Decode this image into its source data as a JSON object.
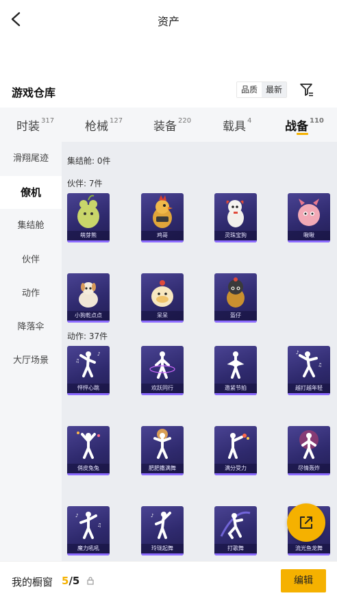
{
  "header": {
    "title": "资产"
  },
  "section": {
    "title": "游戏仓库",
    "sort_options": [
      "品质",
      "最新"
    ],
    "active_sort": "最新"
  },
  "category_tabs": [
    {
      "label": "时装",
      "count": "317"
    },
    {
      "label": "枪械",
      "count": "127"
    },
    {
      "label": "装备",
      "count": "220"
    },
    {
      "label": "载具",
      "count": "4"
    },
    {
      "label": "战备",
      "count": "110",
      "active": true
    }
  ],
  "side_menu": {
    "items": [
      "滑翔尾迹",
      "僚机",
      "集结舱",
      "伙伴",
      "动作",
      "降落伞",
      "大厅场景"
    ],
    "active": "僚机"
  },
  "content": {
    "groups": [
      {
        "label": "集结舱: 0件",
        "items": []
      },
      {
        "label": "伙伴: 7件",
        "items": [
          "萌芽熊",
          "鸡哥",
          "灵珠宝狗",
          "啾啾",
          "小狗乾点点",
          "呆呆",
          "盔仔"
        ]
      },
      {
        "label": "动作: 37件",
        "items": [
          "怦怦心跳",
          "欢跃同行",
          "邀紧节拍",
          "越打越年轻",
          "俏皮兔兔",
          "肥肥撒满舞",
          "满分受力",
          "尽情轰炸",
          "魔力吼吼",
          "玲珑起舞",
          "打歌舞",
          "流光鱼龙舞"
        ]
      }
    ]
  },
  "footer": {
    "showcase_label": "我的橱窗",
    "showcase_current": "5",
    "showcase_total": "/5",
    "edit_label": "编辑"
  },
  "colors": {
    "accent": "#f5b100",
    "card_bg": "#2f2a6e",
    "card_bar": "#8c6bff"
  },
  "icons": [
    "back-arrow-icon",
    "filter-icon",
    "lock-icon",
    "share-icon"
  ]
}
